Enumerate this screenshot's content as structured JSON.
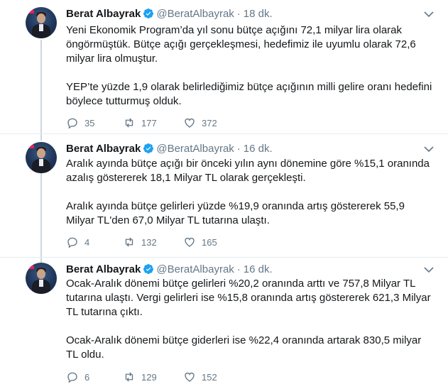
{
  "tweets": [
    {
      "name": "Berat Albayrak",
      "handle": "@BeratAlbayrak",
      "time": "18 dk.",
      "paragraphs": [
        "Yeni Ekonomik Program’da yıl sonu bütçe açığını 72,1 milyar lira olarak öngörmüştük. Bütçe açığı gerçekleşmesi, hedefimiz ile uyumlu olarak 72,6 milyar lira olmuştur.",
        "YEP’te yüzde 1,9 olarak belirlediğimiz bütçe açığının milli gelire oranı hedefini böylece tutturmuş olduk."
      ],
      "replies": "35",
      "retweets": "177",
      "likes": "372"
    },
    {
      "name": "Berat Albayrak",
      "handle": "@BeratAlbayrak",
      "time": "16 dk.",
      "paragraphs": [
        "Aralık ayında bütçe açığı bir önceki yılın aynı dönemine göre %15,1 oranında azalış göstererek 18,1 Milyar TL olarak gerçekleşti.",
        "Aralık ayında bütçe gelirleri yüzde %19,9 oranında artış göstererek 55,9 Milyar TL'den 67,0 Milyar TL tutarına ulaştı."
      ],
      "replies": "4",
      "retweets": "132",
      "likes": "165"
    },
    {
      "name": "Berat Albayrak",
      "handle": "@BeratAlbayrak",
      "time": "16 dk.",
      "paragraphs": [
        "Ocak-Aralık dönemi bütçe gelirleri %20,2 oranında arttı ve 757,8 Milyar TL tutarına ulaştı. Vergi gelirleri ise %15,8 oranında artış göstererek 621,3 Milyar TL tutarına çıktı.",
        "Ocak-Aralık dönemi bütçe giderleri ise %22,4 oranında artarak 830,5 milyar TL oldu."
      ],
      "replies": "6",
      "retweets": "129",
      "likes": "152"
    }
  ],
  "colors": {
    "verified": "#1da1f2",
    "icon": "#657786",
    "thread": "#ccd6dd"
  }
}
